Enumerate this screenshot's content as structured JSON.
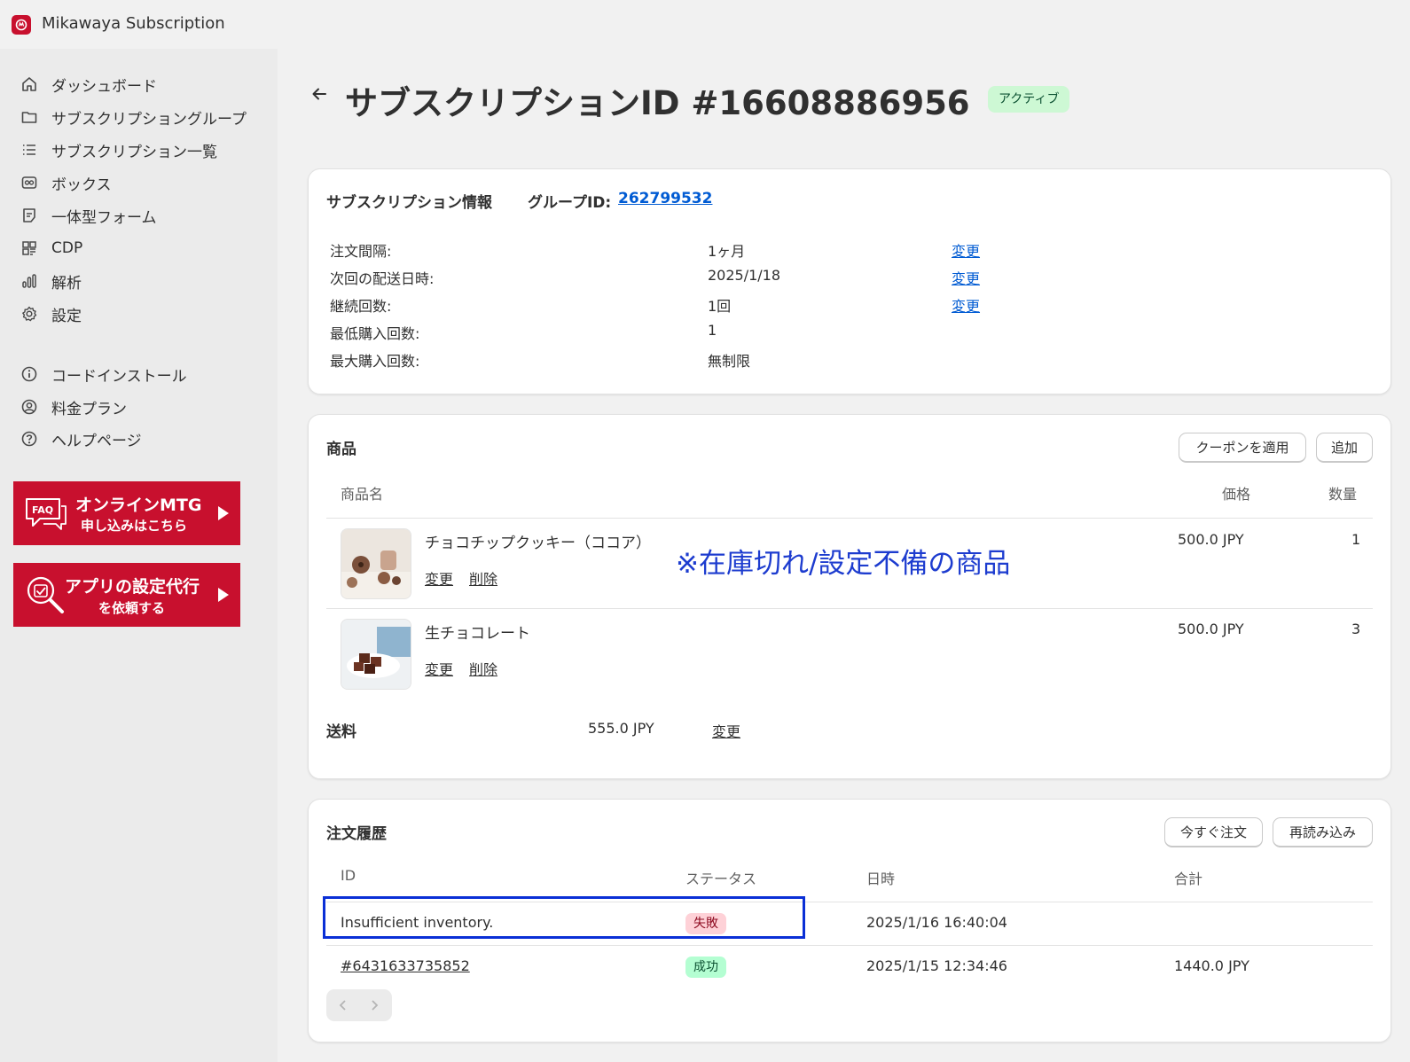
{
  "app": {
    "title": "Mikawaya Subscription"
  },
  "sidebar": {
    "items": [
      {
        "label": "ダッシュボード",
        "icon": "home-icon"
      },
      {
        "label": "サブスクリプショングループ",
        "icon": "folder-icon"
      },
      {
        "label": "サブスクリプション一覧",
        "icon": "list-icon"
      },
      {
        "label": "ボックス",
        "icon": "box-icon"
      },
      {
        "label": "一体型フォーム",
        "icon": "form-icon"
      },
      {
        "label": "CDP",
        "icon": "grid-icon"
      },
      {
        "label": "解析",
        "icon": "chart-icon"
      },
      {
        "label": "設定",
        "icon": "gear-icon"
      }
    ],
    "secondary": [
      {
        "label": "コードインストール",
        "icon": "info-icon"
      },
      {
        "label": "料金プラン",
        "icon": "user-circle-icon"
      },
      {
        "label": "ヘルプページ",
        "icon": "help-icon"
      }
    ],
    "banners": [
      {
        "badge": "FAQ",
        "line1": "オンラインMTG",
        "line2": "申し込みはこちら"
      },
      {
        "line1": "アプリの設定代行",
        "line2": "を依頼する"
      }
    ]
  },
  "header": {
    "title": "サブスクリプションID #16608886956",
    "status": "アクティブ"
  },
  "info": {
    "title": "サブスクリプション情報",
    "group_label": "グループID:",
    "group_id": "262799532",
    "rows": [
      {
        "label": "注文間隔:",
        "value": "1ヶ月",
        "action": "変更"
      },
      {
        "label": "次回の配送日時:",
        "value": "2025/1/18",
        "action": "変更"
      },
      {
        "label": "継続回数:",
        "value": "1回",
        "action": "変更"
      },
      {
        "label": "最低購入回数:",
        "value": "1"
      },
      {
        "label": "最大購入回数:",
        "value": "無制限"
      }
    ]
  },
  "products": {
    "title": "商品",
    "coupon_button": "クーポンを適用",
    "add_button": "追加",
    "headers": {
      "name": "商品名",
      "price": "価格",
      "qty": "数量"
    },
    "items": [
      {
        "name": "チョコチップクッキー（ココア）",
        "price": "500.0 JPY",
        "qty": "1",
        "edit": "変更",
        "delete": "削除"
      },
      {
        "name": "生チョコレート",
        "price": "500.0 JPY",
        "qty": "3",
        "edit": "変更",
        "delete": "削除"
      }
    ],
    "annotation": "※在庫切れ/設定不備の商品",
    "shipping": {
      "label": "送料",
      "value": "555.0 JPY",
      "action": "変更"
    }
  },
  "orders": {
    "title": "注文履歴",
    "order_now_button": "今すぐ注文",
    "reload_button": "再読み込み",
    "headers": {
      "id": "ID",
      "status": "ステータス",
      "date": "日時",
      "total": "合計"
    },
    "rows": [
      {
        "id": "Insufficient inventory.",
        "status": "失敗",
        "date": "2025/1/16 16:40:04",
        "total": ""
      },
      {
        "id": "#6431633735852",
        "status": "成功",
        "date": "2025/1/15 12:34:46",
        "total": "1440.0 JPY"
      }
    ]
  },
  "colors": {
    "brand": "#c8102e",
    "link": "#005bd3",
    "annotation": "#1d3ccf",
    "highlight": "#0a2fd6"
  }
}
